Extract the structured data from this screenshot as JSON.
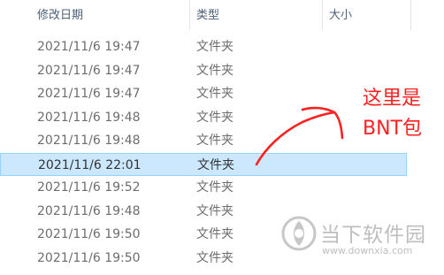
{
  "columns": {
    "date": "修改日期",
    "type": "类型",
    "size": "大小"
  },
  "rows": [
    {
      "date": "2021/11/6 19:47",
      "type": "文件夹",
      "selected": false
    },
    {
      "date": "2021/11/6 19:47",
      "type": "文件夹",
      "selected": false
    },
    {
      "date": "2021/11/6 19:47",
      "type": "文件夹",
      "selected": false
    },
    {
      "date": "2021/11/6 19:48",
      "type": "文件夹",
      "selected": false
    },
    {
      "date": "2021/11/6 19:48",
      "type": "文件夹",
      "selected": false
    },
    {
      "date": "2021/11/6 22:01",
      "type": "文件夹",
      "selected": true
    },
    {
      "date": "2021/11/6 19:52",
      "type": "文件夹",
      "selected": false
    },
    {
      "date": "2021/11/6 19:48",
      "type": "文件夹",
      "selected": false
    },
    {
      "date": "2021/11/6 19:50",
      "type": "文件夹",
      "selected": false
    },
    {
      "date": "2021/11/6 19:50",
      "type": "文件夹",
      "selected": false
    }
  ],
  "annotation": {
    "line1": "这里是",
    "line2": "BNT包",
    "color": "#ff2020"
  },
  "watermark": {
    "name": "当下软件园",
    "url": "www.downxia.com",
    "icon": "downxia-logo-icon"
  },
  "colors": {
    "selected_bg": "#cce8ff",
    "selected_border": "#99d1ff",
    "text": "#6d6d6d",
    "header_text": "#4c607a"
  }
}
